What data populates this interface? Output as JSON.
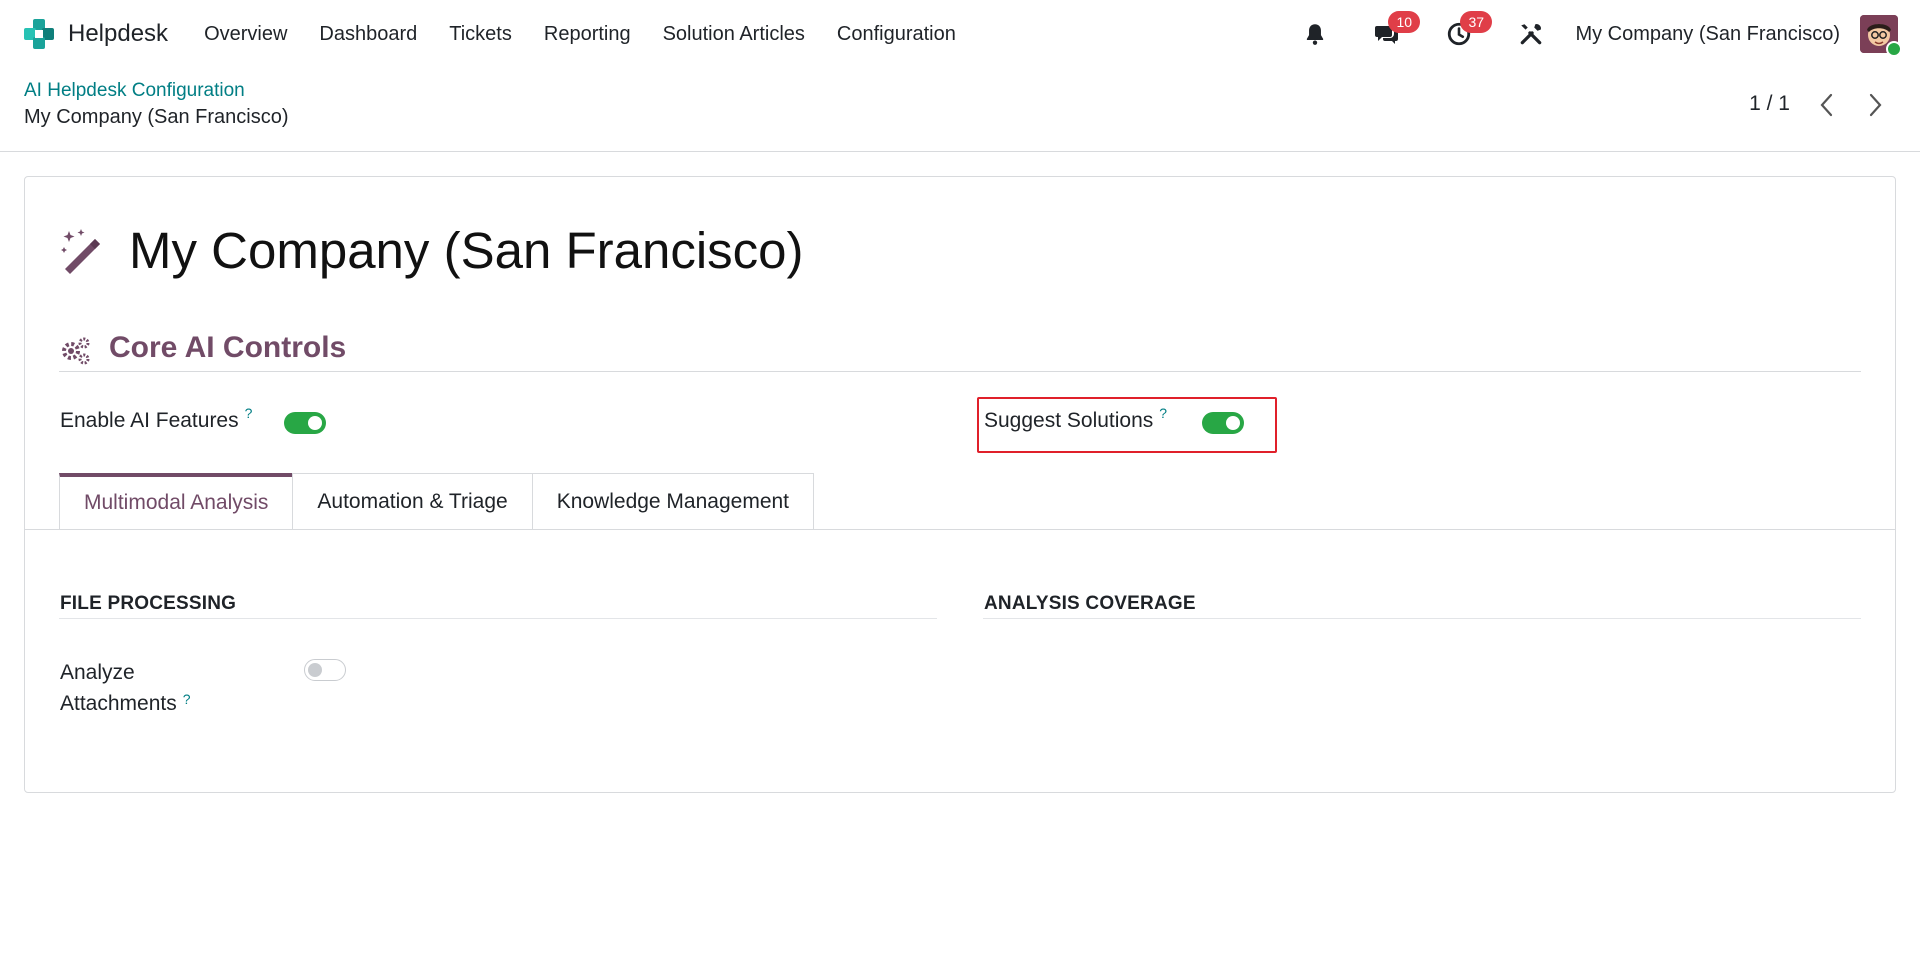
{
  "navbar": {
    "app_name": "Helpdesk",
    "menu": [
      "Overview",
      "Dashboard",
      "Tickets",
      "Reporting",
      "Solution Articles",
      "Configuration"
    ],
    "messages_count": "10",
    "activities_count": "37",
    "company": "My Company (San Francisco)"
  },
  "control_panel": {
    "breadcrumb_parent": "AI Helpdesk Configuration",
    "breadcrumb_current": "My Company (San Francisco)",
    "pager": "1 / 1"
  },
  "form": {
    "title": "My Company (San Francisco)",
    "section_title": "Core AI Controls",
    "fields": {
      "enable_ai": {
        "label": "Enable AI Features",
        "help": "?",
        "value": true
      },
      "suggest_solutions": {
        "label": "Suggest Solutions",
        "help": "?",
        "value": true
      }
    },
    "tabs": [
      "Multimodal Analysis",
      "Automation & Triage",
      "Knowledge Management"
    ],
    "active_tab": "Multimodal Analysis",
    "tab_content": {
      "file_processing_title": "FILE PROCESSING",
      "analysis_coverage_title": "ANALYSIS COVERAGE",
      "analyze_attachments": {
        "label_line1": "Analyze",
        "label_line2": "Attachments",
        "help": "?",
        "value": false
      }
    }
  },
  "colors": {
    "brand_purple": "#714b67",
    "link_teal": "#017e84",
    "toggle_on": "#28a745",
    "badge_red": "#e03e48",
    "highlight_red": "#e0202a"
  }
}
